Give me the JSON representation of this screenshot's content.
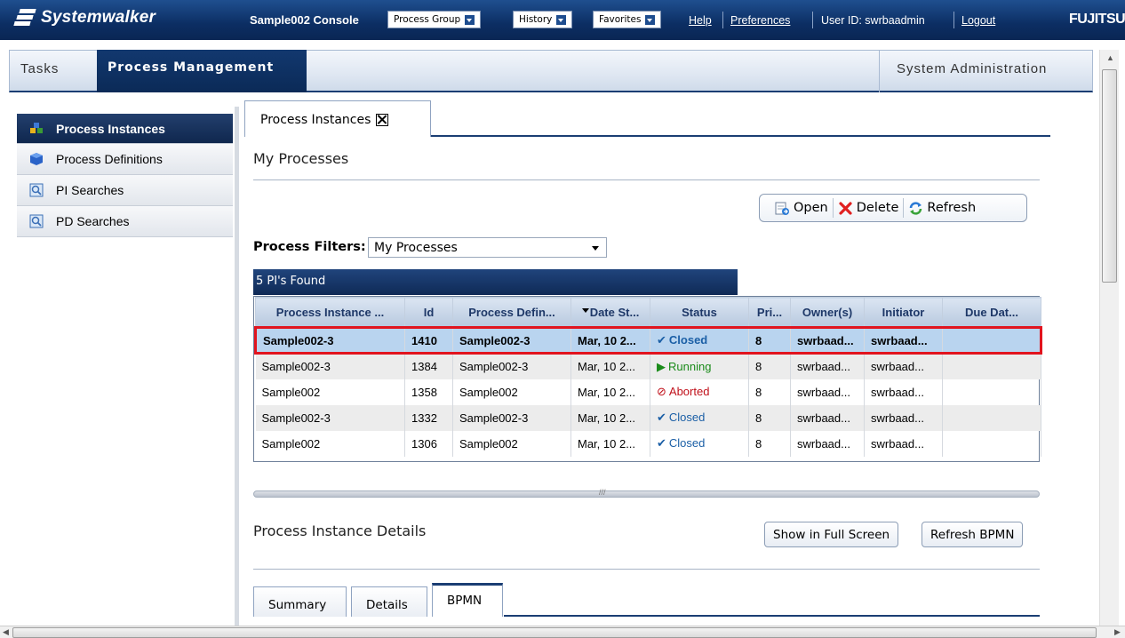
{
  "header": {
    "brand": "Systemwalker",
    "console_title": "Sample002 Console",
    "menus": [
      {
        "label": "Process Group"
      },
      {
        "label": "History"
      },
      {
        "label": "Favorites"
      }
    ],
    "links": {
      "help": "Help",
      "preferences": "Preferences",
      "logout": "Logout"
    },
    "user_id": "User ID: swrbaadmin",
    "vendor": "FUJITSU"
  },
  "tabs": {
    "tasks": "Tasks",
    "process_management": "Process Management",
    "system_administration": "System Administration"
  },
  "sidebar": {
    "items": [
      {
        "label": "Process Instances",
        "icon": "process-instances-icon",
        "active": true
      },
      {
        "label": "Process Definitions",
        "icon": "process-definitions-icon"
      },
      {
        "label": "PI Searches",
        "icon": "search-icon"
      },
      {
        "label": "PD Searches",
        "icon": "search-icon"
      }
    ]
  },
  "panel": {
    "tab_label": "Process Instances",
    "section_title": "My Processes",
    "actions": {
      "open": "Open",
      "delete": "Delete",
      "refresh": "Refresh"
    },
    "filters_label": "Process Filters:",
    "filter_value": "My Processes",
    "found_text": "5 PI's Found",
    "columns": [
      "Process Instance ...",
      "Id",
      "Process Defin...",
      "Date St...",
      "Status",
      "Pri...",
      "Owner(s)",
      "Initiator",
      "Due Dat..."
    ],
    "rows": [
      {
        "instance": "Sample002-3",
        "id": "1410",
        "definition": "Sample002-3",
        "date": "Mar, 10 2...",
        "status": "Closed",
        "priority": "8",
        "owner": "swrbaad...",
        "initiator": "swrbaad...",
        "due": ""
      },
      {
        "instance": "Sample002-3",
        "id": "1384",
        "definition": "Sample002-3",
        "date": "Mar, 10 2...",
        "status": "Running",
        "priority": "8",
        "owner": "swrbaad...",
        "initiator": "swrbaad...",
        "due": ""
      },
      {
        "instance": "Sample002",
        "id": "1358",
        "definition": "Sample002",
        "date": "Mar, 10 2...",
        "status": "Aborted",
        "priority": "8",
        "owner": "swrbaad...",
        "initiator": "swrbaad...",
        "due": ""
      },
      {
        "instance": "Sample002-3",
        "id": "1332",
        "definition": "Sample002-3",
        "date": "Mar, 10 2...",
        "status": "Closed",
        "priority": "8",
        "owner": "swrbaad...",
        "initiator": "swrbaad...",
        "due": ""
      },
      {
        "instance": "Sample002",
        "id": "1306",
        "definition": "Sample002",
        "date": "Mar, 10 2...",
        "status": "Closed",
        "priority": "8",
        "owner": "swrbaad...",
        "initiator": "swrbaad...",
        "due": ""
      }
    ],
    "details_title": "Process Instance Details",
    "details_buttons": {
      "full_screen": "Show in Full Screen",
      "refresh_bpmn": "Refresh BPMN"
    },
    "detail_tabs": [
      "Summary",
      "Details",
      "BPMN"
    ]
  },
  "colors": {
    "header_navy": "#0c2e63",
    "selection_outline": "#e1141e",
    "selected_row": "#b9d4ef"
  }
}
